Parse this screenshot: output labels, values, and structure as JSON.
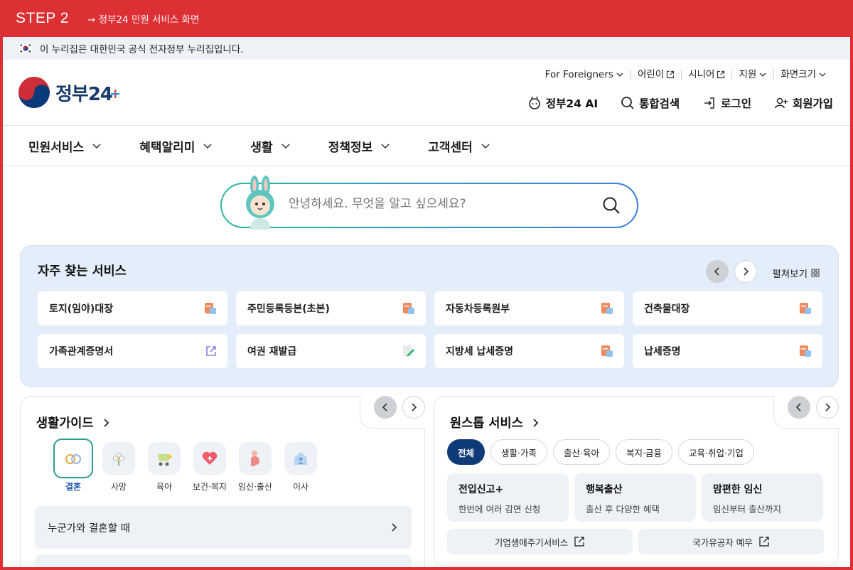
{
  "step": {
    "title": "STEP 2",
    "desc": "→ 정부24 민원 서비스 화면"
  },
  "notice": {
    "text": "이 누리집은 대한민국 공식 전자정부 누리집입니다."
  },
  "logo": {
    "text": "정부24"
  },
  "util_nav": [
    {
      "label": "For Foreigners",
      "icon": "chevron-down-icon"
    },
    {
      "label": "어린이",
      "icon": "external-link-icon"
    },
    {
      "label": "시니어",
      "icon": "external-link-icon"
    },
    {
      "label": "지원",
      "icon": "chevron-down-icon"
    },
    {
      "label": "화면크기",
      "icon": "chevron-down-icon"
    }
  ],
  "main_util": [
    {
      "label": "정부24 AI",
      "icon": "ai-mascot-icon"
    },
    {
      "label": "통합검색",
      "icon": "search-icon"
    },
    {
      "label": "로그인",
      "icon": "login-icon"
    },
    {
      "label": "회원가입",
      "icon": "user-add-icon"
    }
  ],
  "gnb": [
    "민원서비스",
    "혜택알리미",
    "생활",
    "정책정보",
    "고객센터"
  ],
  "search": {
    "placeholder": "안녕하세요. 무엇을 알고 싶으세요?"
  },
  "frequent": {
    "title": "자주 찾는 서비스",
    "expand_label": "펼쳐보기",
    "items": [
      {
        "label": "토지(임야)대장",
        "icon": "document-icon"
      },
      {
        "label": "주민등록등본(초본)",
        "icon": "document-icon"
      },
      {
        "label": "자동차등록원부",
        "icon": "document-icon"
      },
      {
        "label": "건축물대장",
        "icon": "document-icon"
      },
      {
        "label": "가족관계증명서",
        "icon": "external-link-icon"
      },
      {
        "label": "여권 재발급",
        "icon": "edit-icon"
      },
      {
        "label": "지방세 납세증명",
        "icon": "document-icon"
      },
      {
        "label": "납세증명",
        "icon": "document-icon"
      }
    ]
  },
  "life_guide": {
    "title": "생활가이드",
    "categories": [
      {
        "label": "결혼",
        "icon": "rings-icon",
        "active": true
      },
      {
        "label": "사망",
        "icon": "flower-icon"
      },
      {
        "label": "육아",
        "icon": "stroller-icon"
      },
      {
        "label": "보건·복지",
        "icon": "heart-icon"
      },
      {
        "label": "임신·출산",
        "icon": "pregnancy-icon"
      },
      {
        "label": "이사",
        "icon": "house-icon"
      }
    ],
    "rows": [
      "누군가와 결혼할 때",
      ""
    ]
  },
  "onestop": {
    "title": "원스톱 서비스",
    "chips": [
      {
        "label": "전체",
        "active": true
      },
      {
        "label": "생활·가족"
      },
      {
        "label": "출산·육아"
      },
      {
        "label": "복지·금융"
      },
      {
        "label": "교육·취업·기업"
      }
    ],
    "cards": [
      {
        "title": "전입신고+",
        "desc": "한번에 여러 감면 신청"
      },
      {
        "title": "행복출산",
        "desc": "출산 후 다양한 혜택"
      },
      {
        "title": "맘편한 임신",
        "desc": "임신부터 출산까지"
      }
    ],
    "links": [
      {
        "label": "기업생애주기서비스",
        "icon": "external-link-icon"
      },
      {
        "label": "국가유공자 예우",
        "icon": "external-link-icon"
      }
    ]
  },
  "colors": {
    "accent_red": "#dc3035",
    "navy": "#0f3a78",
    "freq_bg": "#e3eefa"
  }
}
